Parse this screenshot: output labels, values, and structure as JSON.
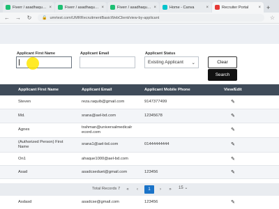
{
  "browser": {
    "tabs": [
      {
        "label": "Fiverr / asadhaque2029...",
        "fav_color": "#1dbf73",
        "active": false
      },
      {
        "label": "Fiverr / asadhaque2029...",
        "fav_color": "#1dbf73",
        "active": false
      },
      {
        "label": "Fiverr / asadhaque2029...",
        "fav_color": "#1dbf73",
        "active": false
      },
      {
        "label": "Home - Canva",
        "fav_color": "#00c4cc",
        "active": false
      },
      {
        "label": "Recruiter Portal",
        "fav_color": "#e53935",
        "active": true
      }
    ],
    "close_glyph": "×",
    "newtab_glyph": "+",
    "url": "umrtest.com/UMRRecruitmentBasicWebClient/view-by-applicant",
    "nav_back": "←",
    "nav_forward": "→",
    "nav_reload": "↻",
    "lock_glyph": "🔒",
    "star_glyph": "☆"
  },
  "filters": {
    "first_name_label": "Applicant First Name",
    "first_name_value": "",
    "email_label": "Applicant Email",
    "email_value": "",
    "status_label": "Applicant Status",
    "status_value": "Existing Applicant",
    "status_chevron": "⌄",
    "clear_label": "Clear",
    "search_label": "Search"
  },
  "table": {
    "headers": [
      "Applicant First Name",
      "Applicant Email",
      "Applicant Mobile Phone",
      "View/Edit"
    ],
    "edit_glyph": "✎",
    "rows": [
      {
        "first_name_l1": "Steven",
        "first_name_l2": "",
        "email_l1": "reza.raquib@gmail.com",
        "email_l2": "",
        "phone": "9147377499"
      },
      {
        "first_name_l1": "Md.",
        "first_name_l2": "",
        "email_l1": "srana@ael-bd.com",
        "email_l2": "",
        "phone": "12345678"
      },
      {
        "first_name_l1": "Agnes",
        "first_name_l2": "",
        "email_l1": "trahman@universalmedicalr",
        "email_l2": "ecord.com",
        "phone": ""
      },
      {
        "first_name_l1": "(Authorized Person) First",
        "first_name_l2": "Name",
        "email_l1": "srana1@ael-bd.com",
        "email_l2": "",
        "phone": "01444444444"
      },
      {
        "first_name_l1": "On1",
        "first_name_l2": "",
        "email_l1": "ahaque1000@ael-bd.com",
        "email_l2": "",
        "phone": ""
      },
      {
        "first_name_l1": "Asad",
        "first_name_l2": "",
        "email_l1": "asadcseduet@gmail.com",
        "email_l2": "",
        "phone": "123456"
      },
      {
        "first_name_l1": "Asdasd",
        "first_name_l2": "",
        "email_l1": "asadcse@gmail.com",
        "email_l2": "",
        "phone": "123456"
      }
    ]
  },
  "pagination": {
    "total_text": "Total Records 7",
    "first": "«",
    "prev": "‹",
    "current": "1",
    "next": "›",
    "last": "»",
    "page_size": "15 ⌄"
  },
  "colors": {
    "table_header": "#3f4b59",
    "active_page": "#1a73c8",
    "search_button": "#111111"
  }
}
